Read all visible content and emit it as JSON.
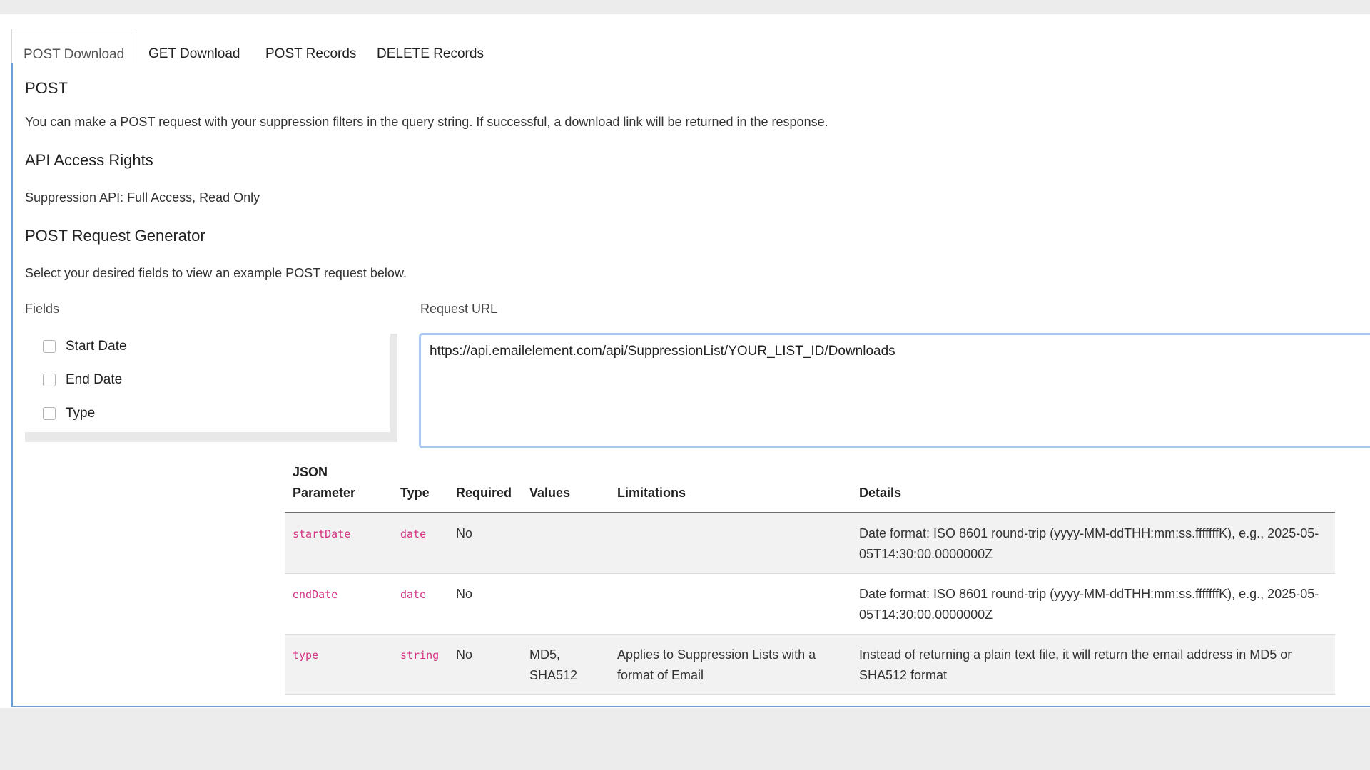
{
  "tabs": [
    {
      "label": "POST Download",
      "active": true
    },
    {
      "label": "GET Download",
      "active": false
    },
    {
      "label": "POST Records",
      "active": false
    },
    {
      "label": "DELETE Records",
      "active": false
    }
  ],
  "post": {
    "heading": "POST",
    "description": "You can make a POST request with your suppression filters in the query string. If successful, a download link will be returned in the response."
  },
  "access": {
    "heading": "API Access Rights",
    "text": "Suppression API: Full Access, Read Only"
  },
  "generator": {
    "heading": "POST Request Generator",
    "text": "Select your desired fields to view an example POST request below.",
    "fields_label": "Fields",
    "request_url_label": "Request URL",
    "fields": [
      "Start Date",
      "End Date",
      "Type"
    ],
    "request_url": "https://api.emailelement.com/api/SuppressionList/YOUR_LIST_ID/Downloads"
  },
  "table": {
    "headers": {
      "param_line1": "JSON",
      "param_line2": "Parameter",
      "type": "Type",
      "required": "Required",
      "values": "Values",
      "limitations": "Limitations",
      "details": "Details"
    },
    "rows": [
      {
        "param": "startDate",
        "type": "date",
        "required": "No",
        "values": "",
        "limitations": "",
        "details": "Date format: ISO 8601 round-trip (yyyy-MM-ddTHH:mm:ss.fffffffK), e.g., 2025-05-05T14:30:00.0000000Z"
      },
      {
        "param": "endDate",
        "type": "date",
        "required": "No",
        "values": "",
        "limitations": "",
        "details": "Date format: ISO 8601 round-trip (yyyy-MM-ddTHH:mm:ss.fffffffK), e.g., 2025-05-05T14:30:00.0000000Z"
      },
      {
        "param": "type",
        "type": "string",
        "required": "No",
        "values": "MD5, SHA512",
        "limitations": "Applies to Suppression Lists with a format of Email",
        "details": "Instead of returning a plain text file, it will return the email address in MD5 or SHA512 format"
      }
    ]
  }
}
